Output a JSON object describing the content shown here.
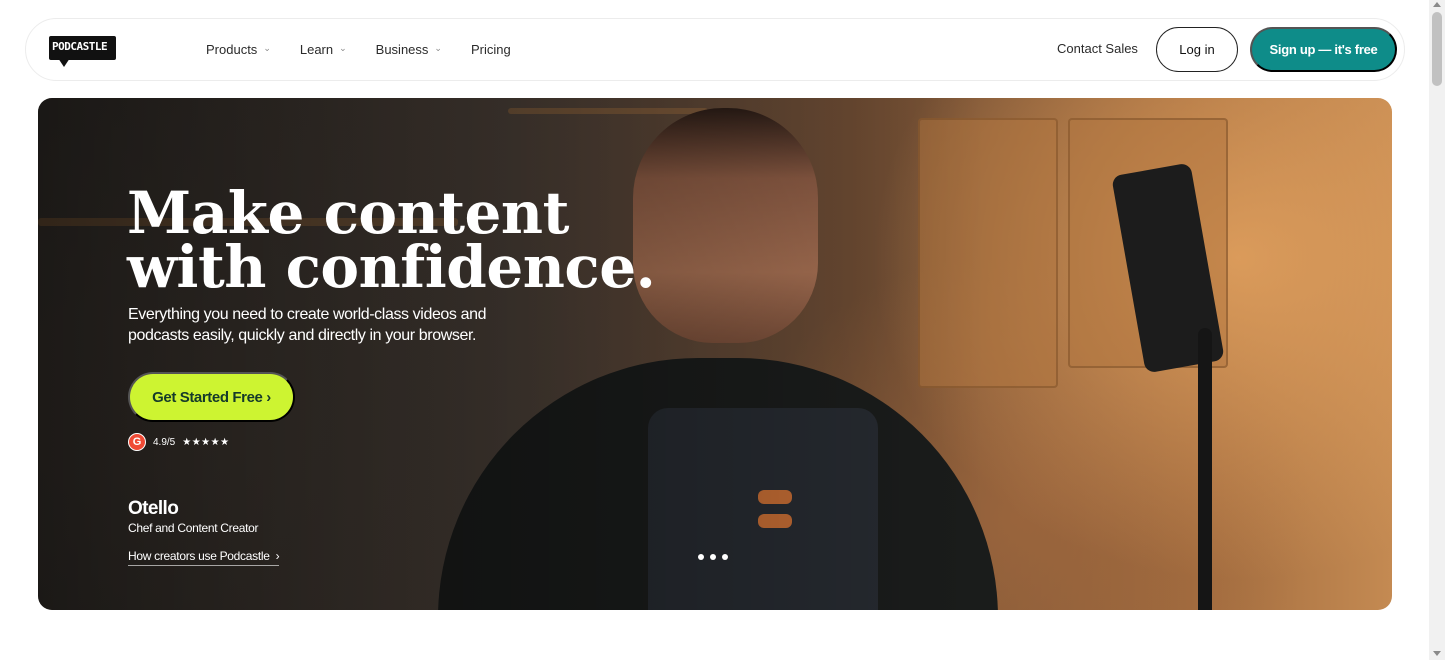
{
  "brand": {
    "logo_text": "PODCASTLE"
  },
  "nav": {
    "items": [
      {
        "label": "Products",
        "has_dropdown": true
      },
      {
        "label": "Learn",
        "has_dropdown": true
      },
      {
        "label": "Business",
        "has_dropdown": true
      },
      {
        "label": "Pricing",
        "has_dropdown": false
      }
    ],
    "contact_label": "Contact Sales",
    "login_label": "Log in",
    "signup_label": "Sign up — it's free"
  },
  "hero": {
    "headline_line1": "Make content",
    "headline_line2": "with confidence.",
    "subhead": "Everything you need to create world-class videos and podcasts easily, quickly and directly in your browser.",
    "cta_label": "Get Started Free ›",
    "rating": {
      "icon": "g2-icon",
      "icon_text": "G",
      "score": "4.9/5",
      "stars": "★★★★★"
    },
    "creator": {
      "name": "Otello",
      "role": "Chef and Content Creator",
      "link_label": "How creators use Podcastle",
      "link_arrow": "›"
    },
    "carousel": {
      "slides": 3
    }
  },
  "colors": {
    "signup_bg": "#0e8c89",
    "cta_bg": "#cdf431",
    "cta_text": "#153a2a",
    "g2_red": "#ef4a35"
  }
}
